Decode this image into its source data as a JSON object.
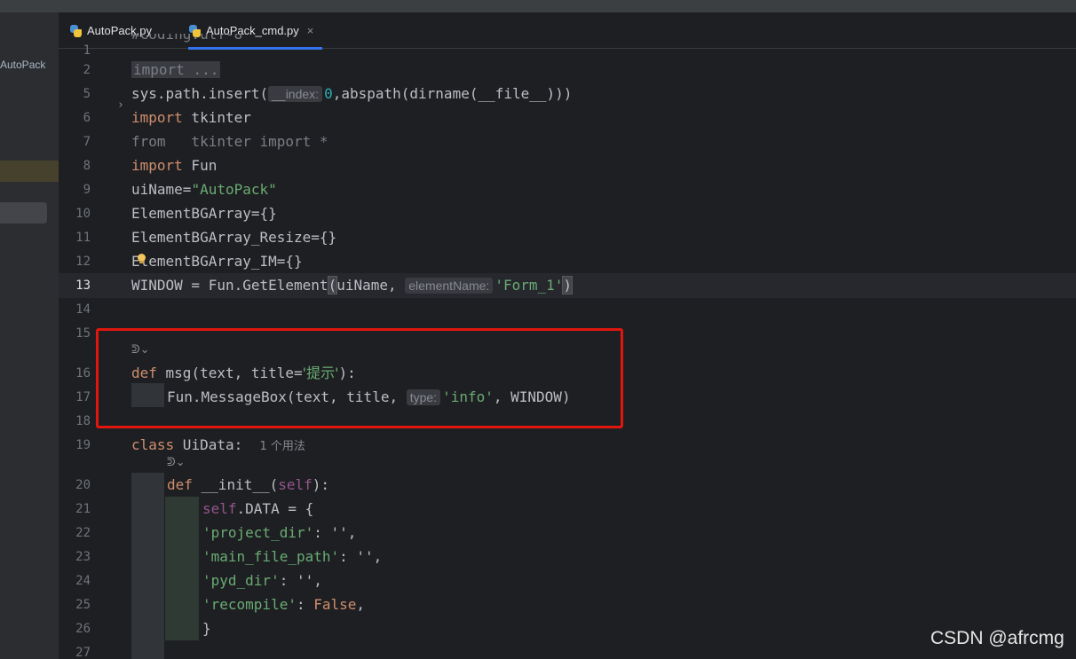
{
  "sidebar": {
    "project_label": "AutoPack"
  },
  "tabs": [
    {
      "label": "AutoPack.py",
      "icon": "python-file-icon",
      "active": false
    },
    {
      "label": "AutoPack_cmd.py",
      "icon": "python-file-icon",
      "active": true,
      "close": "×"
    }
  ],
  "gutter": {
    "line_numbers": [
      "1",
      "2",
      "5",
      "6",
      "7",
      "8",
      "9",
      "10",
      "11",
      "12",
      "13",
      "14",
      "15",
      "16",
      "17",
      "18",
      "19",
      "20",
      "21",
      "22",
      "23",
      "24",
      "25",
      "26",
      "27"
    ],
    "current_line": "13",
    "fold_marker": "›"
  },
  "code": {
    "l2_import": "import",
    "l2_folded": "...",
    "l5_pre": "sys.path.insert(",
    "l5_hint": "__index:",
    "l5_num": "0",
    "l5_post": ",abspath(dirname(__file__)))",
    "l6_kw": "import",
    "l6_rest": " tkinter",
    "l7_text": "from   tkinter import *",
    "l8_kw": "import",
    "l8_rest": " Fun",
    "l9_pre": "uiName=",
    "l9_str": "\"AutoPack\"",
    "l10": "ElementBGArray={}",
    "l11": "ElementBGArray_Resize={}",
    "l12": "ElementBGArray_IM={}",
    "l13_pre": "WINDOW = Fun.GetElement",
    "l13_paren": "(",
    "l13_mid": "uiName, ",
    "l13_hint": "elementName:",
    "l13_str": "'Form_1'",
    "l13_close": ")",
    "l16_kw": "def",
    "l16_pre": " msg(text, title=",
    "l16_str": "'提示'",
    "l16_post": "):",
    "l17_pre": "Fun.MessageBox(text, title, ",
    "l17_hint": "type:",
    "l17_str": "'info'",
    "l17_post": ", WINDOW)",
    "l19_kw": "class",
    "l19_rest": " UiData:",
    "l19_usage": "1 个用法",
    "l20_kw": "def",
    "l20_rest": " __init__(",
    "l20_self": "self",
    "l20_post": "):",
    "l21_self": "self",
    "l21_rest": ".DATA = {",
    "l22_str": "'project_dir'",
    "l22_post": ": '',",
    "l23_str": "'main_file_path'",
    "l23_post": ": '',",
    "l24_str": "'pyd_dir'",
    "l24_post": ": '',",
    "l25_str": "'recompile'",
    "l25_mid": ": ",
    "l25_kw": "False",
    "l25_post": ",",
    "l26": "}",
    "l1_partial": "#coding:utf-8"
  },
  "lens_marker": "ᕲ⌄",
  "watermark": "CSDN @afrcmg",
  "colors": {
    "keyword": "#cf8e6d",
    "string": "#6aab73",
    "number": "#2aacb8",
    "self": "#94558d",
    "annotation_border": "#e0160f",
    "tab_accent": "#3574f0"
  }
}
